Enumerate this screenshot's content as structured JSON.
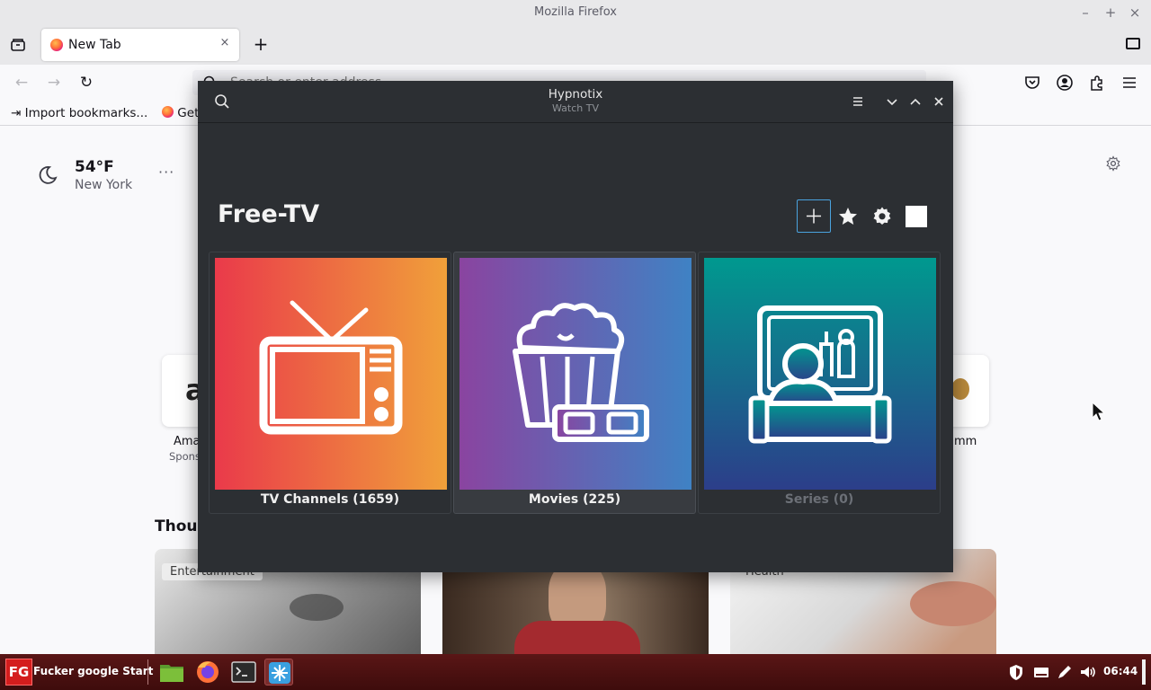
{
  "os": {
    "window_title": "Mozilla Firefox",
    "window_controls": {
      "minimize": "–",
      "maximize": "+",
      "close": "×"
    }
  },
  "browser": {
    "tab": {
      "title": "New Tab",
      "close": "×"
    },
    "new_tab_symbol": "+",
    "nav": {
      "back": "←",
      "forward": "→",
      "reload": "↻"
    },
    "urlbar": {
      "placeholder": "Search or enter address"
    },
    "bookmarks": [
      {
        "label": "Import bookmarks..."
      },
      {
        "label": "Getting Started"
      }
    ],
    "icons": [
      "tab-list-icon",
      "search-icon",
      "pocket-icon",
      "account-icon",
      "extensions-icon",
      "menu-icon",
      "folder-icon"
    ]
  },
  "newtab": {
    "weather": {
      "temperature": "54°F",
      "city": "New York",
      "more": "···"
    },
    "shortcuts": [
      {
        "label": "Ama",
        "sub": "Spons"
      },
      {
        "label": "mm",
        "sub": ""
      }
    ],
    "section_heading": "Thou",
    "stories": [
      {
        "tag": "Entertainment"
      },
      {
        "tag": ""
      },
      {
        "tag": "Health"
      }
    ]
  },
  "hypnotix": {
    "title": "Hypnotix",
    "subtitle": "Watch TV",
    "provider_name": "Free-TV",
    "categories": [
      {
        "label": "TV Channels (1659)",
        "color_from": "#ea3a4a",
        "color_to": "#f0a03a",
        "icon": "tv-icon"
      },
      {
        "label": "Movies (225)",
        "color_from": "#8a44a0",
        "color_to": "#3f82c4",
        "icon": "popcorn-3d-glasses-icon"
      },
      {
        "label": "Series (0)",
        "color_from": "#00998f",
        "color_to": "#2c3e8a",
        "icon": "series-viewer-icon"
      }
    ],
    "accent": "#4aa3df"
  },
  "taskbar": {
    "start_logo": "FG",
    "start_label": "Fucker google Start",
    "clock": "06:44",
    "apps": [
      "files-icon",
      "firefox-icon",
      "terminal-icon",
      "hypnotix-icon"
    ]
  }
}
